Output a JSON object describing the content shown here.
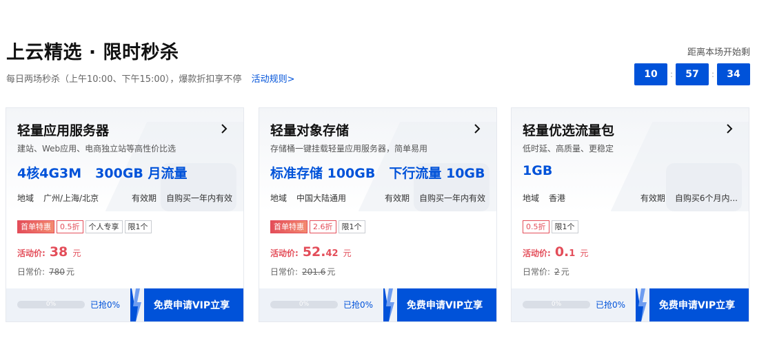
{
  "header": {
    "title": "上云精选 · 限时秒杀",
    "subtitle": "每日两场秒杀（上午10:00、下午15:00），爆款折扣享不停",
    "rules_link": "活动规则>"
  },
  "countdown": {
    "label": "距离本场开始剩",
    "hours": "10",
    "minutes": "57",
    "seconds": "34",
    "separator": ":"
  },
  "colors": {
    "brand": "#0052d9",
    "price": "#e34d59"
  },
  "cards": [
    {
      "title": "轻量应用服务器",
      "description": "建站、Web应用、电商独立站等高性价比选",
      "specs": [
        "4核4G3M",
        "300GB 月流量"
      ],
      "meta": {
        "region_label": "地域",
        "region": "广州/上海/北京",
        "validity_label": "有效期",
        "validity": "自购买一年内有效"
      },
      "tags": [
        "首单特惠",
        "0.5折",
        "个人专享",
        "限1个"
      ],
      "price_label": "活动价:",
      "price_int": "38",
      "price_dec": "",
      "price_unit": "元",
      "orig_label": "日常价:",
      "orig_price": "780",
      "orig_unit": "元",
      "progress_text": "0%",
      "progress": 0,
      "grabbed": "已抢0%",
      "cta": "免费申请VIP立享"
    },
    {
      "title": "轻量对象存储",
      "description": "存储桶一键挂载轻量应用服务器，简单易用",
      "specs": [
        "标准存储 100GB",
        "下行流量 10GB"
      ],
      "meta": {
        "region_label": "地域",
        "region": "中国大陆通用",
        "validity_label": "有效期",
        "validity": "自购买一年内有效"
      },
      "tags": [
        "首单特惠",
        "2.6折",
        "限1个"
      ],
      "price_label": "活动价:",
      "price_int": "52.",
      "price_dec": "42",
      "price_unit": "元",
      "orig_label": "日常价:",
      "orig_price": "201.6",
      "orig_unit": "元",
      "progress_text": "0%",
      "progress": 0,
      "grabbed": "已抢0%",
      "cta": "免费申请VIP立享"
    },
    {
      "title": "轻量优选流量包",
      "description": "低时延、高质量、更稳定",
      "specs": [
        "1GB"
      ],
      "meta": {
        "region_label": "地域",
        "region": "香港",
        "validity_label": "有效期",
        "validity": "自购买6个月内..."
      },
      "tags": [
        "0.5折",
        "限1个"
      ],
      "price_label": "活动价:",
      "price_int": "0.",
      "price_dec": "1",
      "price_unit": "元",
      "orig_label": "日常价:",
      "orig_price": "2",
      "orig_unit": "元",
      "progress_text": "0%",
      "progress": 0,
      "grabbed": "已抢0%",
      "cta": "免费申请VIP立享"
    }
  ]
}
